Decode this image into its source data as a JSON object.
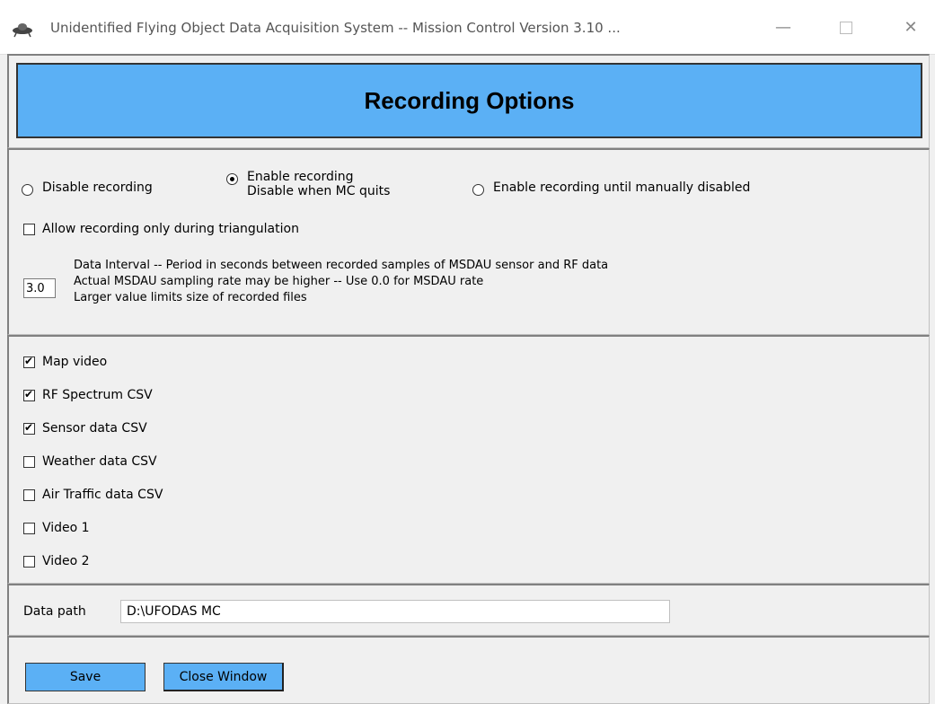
{
  "window": {
    "title": "Unidentified Flying Object Data Acquisition System -- Mission Control   Version 3.10 ...",
    "min_glyph": "—",
    "close_glyph": "✕"
  },
  "header": {
    "title": "Recording Options"
  },
  "recording_mode": {
    "options": [
      {
        "label": "Disable recording",
        "checked": false
      },
      {
        "label_line1": "Enable recording",
        "label_line2": "Disable when MC quits",
        "checked": true
      },
      {
        "label": "Enable recording until manually disabled",
        "checked": false
      }
    ]
  },
  "triangulation_only": {
    "label": "Allow recording only during triangulation",
    "checked": false
  },
  "data_interval": {
    "value": "3.0",
    "lines": [
      "Data Interval -- Period in seconds between recorded samples of MSDAU sensor and RF data",
      "Actual MSDAU sampling rate may be higher -- Use 0.0 for MSDAU rate",
      "Larger value limits size of recorded files"
    ]
  },
  "files": [
    {
      "label": "Map video",
      "checked": true
    },
    {
      "label": "RF Spectrum CSV",
      "checked": true
    },
    {
      "label": "Sensor data CSV",
      "checked": true
    },
    {
      "label": "Weather data CSV",
      "checked": false
    },
    {
      "label": "Air Traffic data CSV",
      "checked": false
    },
    {
      "label": "Video 1",
      "checked": false
    },
    {
      "label": "Video 2",
      "checked": false
    }
  ],
  "data_path": {
    "label": "Data path",
    "value": "D:\\UFODAS MC"
  },
  "buttons": {
    "save": "Save",
    "close": "Close Window"
  },
  "colors": {
    "accent": "#5bb0f5",
    "background": "#f0f0f0"
  }
}
